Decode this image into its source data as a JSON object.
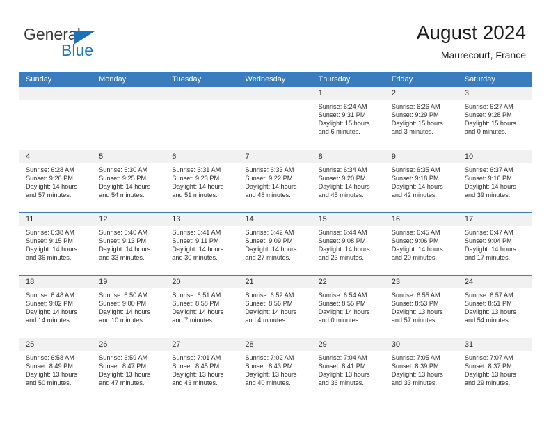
{
  "brand": {
    "name_top": "General",
    "name_bottom": "Blue",
    "triangle_color": "#1c71b8",
    "blue_color": "#1c79c0"
  },
  "header": {
    "title": "August 2024",
    "location": "Maurecourt, France"
  },
  "theme": {
    "header_blue": "#3a7cc0",
    "daynum_band": "#f1f1f1",
    "text": "#2b2b2b"
  },
  "weekdays": [
    "Sunday",
    "Monday",
    "Tuesday",
    "Wednesday",
    "Thursday",
    "Friday",
    "Saturday"
  ],
  "weeks": [
    [
      {
        "day": "",
        "empty": true
      },
      {
        "day": "",
        "empty": true
      },
      {
        "day": "",
        "empty": true
      },
      {
        "day": "",
        "empty": true
      },
      {
        "day": "1",
        "sunrise": "Sunrise: 6:24 AM",
        "sunset": "Sunset: 9:31 PM",
        "daylight_1": "Daylight: 15 hours",
        "daylight_2": "and 6 minutes."
      },
      {
        "day": "2",
        "sunrise": "Sunrise: 6:26 AM",
        "sunset": "Sunset: 9:29 PM",
        "daylight_1": "Daylight: 15 hours",
        "daylight_2": "and 3 minutes."
      },
      {
        "day": "3",
        "sunrise": "Sunrise: 6:27 AM",
        "sunset": "Sunset: 9:28 PM",
        "daylight_1": "Daylight: 15 hours",
        "daylight_2": "and 0 minutes."
      }
    ],
    [
      {
        "day": "4",
        "sunrise": "Sunrise: 6:28 AM",
        "sunset": "Sunset: 9:26 PM",
        "daylight_1": "Daylight: 14 hours",
        "daylight_2": "and 57 minutes."
      },
      {
        "day": "5",
        "sunrise": "Sunrise: 6:30 AM",
        "sunset": "Sunset: 9:25 PM",
        "daylight_1": "Daylight: 14 hours",
        "daylight_2": "and 54 minutes."
      },
      {
        "day": "6",
        "sunrise": "Sunrise: 6:31 AM",
        "sunset": "Sunset: 9:23 PM",
        "daylight_1": "Daylight: 14 hours",
        "daylight_2": "and 51 minutes."
      },
      {
        "day": "7",
        "sunrise": "Sunrise: 6:33 AM",
        "sunset": "Sunset: 9:22 PM",
        "daylight_1": "Daylight: 14 hours",
        "daylight_2": "and 48 minutes."
      },
      {
        "day": "8",
        "sunrise": "Sunrise: 6:34 AM",
        "sunset": "Sunset: 9:20 PM",
        "daylight_1": "Daylight: 14 hours",
        "daylight_2": "and 45 minutes."
      },
      {
        "day": "9",
        "sunrise": "Sunrise: 6:35 AM",
        "sunset": "Sunset: 9:18 PM",
        "daylight_1": "Daylight: 14 hours",
        "daylight_2": "and 42 minutes."
      },
      {
        "day": "10",
        "sunrise": "Sunrise: 6:37 AM",
        "sunset": "Sunset: 9:16 PM",
        "daylight_1": "Daylight: 14 hours",
        "daylight_2": "and 39 minutes."
      }
    ],
    [
      {
        "day": "11",
        "sunrise": "Sunrise: 6:38 AM",
        "sunset": "Sunset: 9:15 PM",
        "daylight_1": "Daylight: 14 hours",
        "daylight_2": "and 36 minutes."
      },
      {
        "day": "12",
        "sunrise": "Sunrise: 6:40 AM",
        "sunset": "Sunset: 9:13 PM",
        "daylight_1": "Daylight: 14 hours",
        "daylight_2": "and 33 minutes."
      },
      {
        "day": "13",
        "sunrise": "Sunrise: 6:41 AM",
        "sunset": "Sunset: 9:11 PM",
        "daylight_1": "Daylight: 14 hours",
        "daylight_2": "and 30 minutes."
      },
      {
        "day": "14",
        "sunrise": "Sunrise: 6:42 AM",
        "sunset": "Sunset: 9:09 PM",
        "daylight_1": "Daylight: 14 hours",
        "daylight_2": "and 27 minutes."
      },
      {
        "day": "15",
        "sunrise": "Sunrise: 6:44 AM",
        "sunset": "Sunset: 9:08 PM",
        "daylight_1": "Daylight: 14 hours",
        "daylight_2": "and 23 minutes."
      },
      {
        "day": "16",
        "sunrise": "Sunrise: 6:45 AM",
        "sunset": "Sunset: 9:06 PM",
        "daylight_1": "Daylight: 14 hours",
        "daylight_2": "and 20 minutes."
      },
      {
        "day": "17",
        "sunrise": "Sunrise: 6:47 AM",
        "sunset": "Sunset: 9:04 PM",
        "daylight_1": "Daylight: 14 hours",
        "daylight_2": "and 17 minutes."
      }
    ],
    [
      {
        "day": "18",
        "sunrise": "Sunrise: 6:48 AM",
        "sunset": "Sunset: 9:02 PM",
        "daylight_1": "Daylight: 14 hours",
        "daylight_2": "and 14 minutes."
      },
      {
        "day": "19",
        "sunrise": "Sunrise: 6:50 AM",
        "sunset": "Sunset: 9:00 PM",
        "daylight_1": "Daylight: 14 hours",
        "daylight_2": "and 10 minutes."
      },
      {
        "day": "20",
        "sunrise": "Sunrise: 6:51 AM",
        "sunset": "Sunset: 8:58 PM",
        "daylight_1": "Daylight: 14 hours",
        "daylight_2": "and 7 minutes."
      },
      {
        "day": "21",
        "sunrise": "Sunrise: 6:52 AM",
        "sunset": "Sunset: 8:56 PM",
        "daylight_1": "Daylight: 14 hours",
        "daylight_2": "and 4 minutes."
      },
      {
        "day": "22",
        "sunrise": "Sunrise: 6:54 AM",
        "sunset": "Sunset: 8:55 PM",
        "daylight_1": "Daylight: 14 hours",
        "daylight_2": "and 0 minutes."
      },
      {
        "day": "23",
        "sunrise": "Sunrise: 6:55 AM",
        "sunset": "Sunset: 8:53 PM",
        "daylight_1": "Daylight: 13 hours",
        "daylight_2": "and 57 minutes."
      },
      {
        "day": "24",
        "sunrise": "Sunrise: 6:57 AM",
        "sunset": "Sunset: 8:51 PM",
        "daylight_1": "Daylight: 13 hours",
        "daylight_2": "and 54 minutes."
      }
    ],
    [
      {
        "day": "25",
        "sunrise": "Sunrise: 6:58 AM",
        "sunset": "Sunset: 8:49 PM",
        "daylight_1": "Daylight: 13 hours",
        "daylight_2": "and 50 minutes."
      },
      {
        "day": "26",
        "sunrise": "Sunrise: 6:59 AM",
        "sunset": "Sunset: 8:47 PM",
        "daylight_1": "Daylight: 13 hours",
        "daylight_2": "and 47 minutes."
      },
      {
        "day": "27",
        "sunrise": "Sunrise: 7:01 AM",
        "sunset": "Sunset: 8:45 PM",
        "daylight_1": "Daylight: 13 hours",
        "daylight_2": "and 43 minutes."
      },
      {
        "day": "28",
        "sunrise": "Sunrise: 7:02 AM",
        "sunset": "Sunset: 8:43 PM",
        "daylight_1": "Daylight: 13 hours",
        "daylight_2": "and 40 minutes."
      },
      {
        "day": "29",
        "sunrise": "Sunrise: 7:04 AM",
        "sunset": "Sunset: 8:41 PM",
        "daylight_1": "Daylight: 13 hours",
        "daylight_2": "and 36 minutes."
      },
      {
        "day": "30",
        "sunrise": "Sunrise: 7:05 AM",
        "sunset": "Sunset: 8:39 PM",
        "daylight_1": "Daylight: 13 hours",
        "daylight_2": "and 33 minutes."
      },
      {
        "day": "31",
        "sunrise": "Sunrise: 7:07 AM",
        "sunset": "Sunset: 8:37 PM",
        "daylight_1": "Daylight: 13 hours",
        "daylight_2": "and 29 minutes."
      }
    ]
  ]
}
